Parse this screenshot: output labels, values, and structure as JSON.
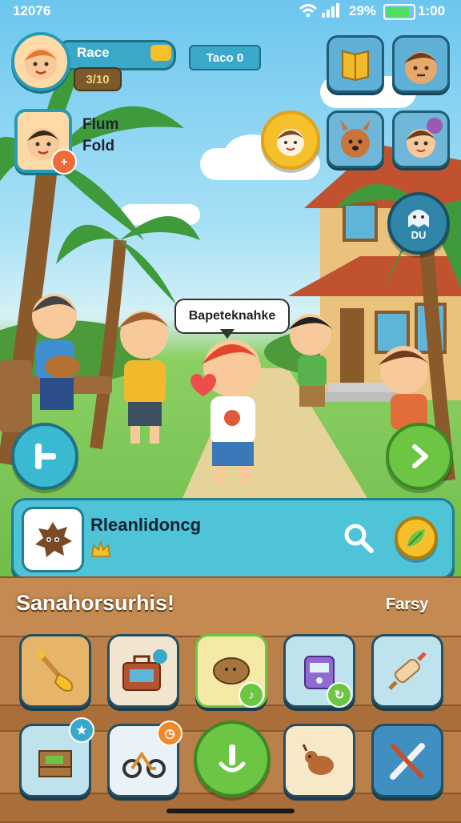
{
  "status_bar": {
    "time_left": "12076",
    "battery_pct": "29%",
    "time_right": "1:00",
    "wifi_icon": "wifi-icon",
    "signal_icon": "signal-icon",
    "battery_icon": "battery-icon"
  },
  "profile": {
    "name": "Race",
    "level": "3/10",
    "xp_fill": 0.78
  },
  "title_plate": {
    "text": "Taco 0"
  },
  "mini_profile": {
    "line1": "Flum",
    "line2": "Fold"
  },
  "speech_bubble": {
    "text": "Bapeteknahke"
  },
  "npc_badge": {
    "text": "DU"
  },
  "search_panel": {
    "title": "Rleanlidoncg"
  },
  "shelf": {
    "title": "Sanahorsurhis!",
    "filter": "Farsy"
  },
  "colors": {
    "accent": "#4fc3d8",
    "green": "#6cc644",
    "wood": "#b9804a",
    "xp": "#f5c02c"
  }
}
